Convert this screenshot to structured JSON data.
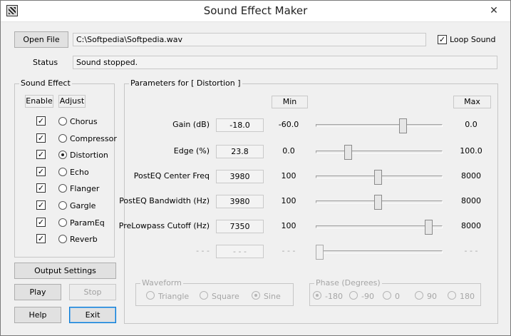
{
  "window": {
    "title": "Sound Effect Maker",
    "close_glyph": "✕"
  },
  "top": {
    "open_file_label": "Open File",
    "file_path": "C:\\Softpedia\\Softpedia.wav",
    "loop_sound_label": "Loop Sound",
    "loop_sound_checked": true,
    "status_label": "Status",
    "status_text": "Sound stopped."
  },
  "sound_effect": {
    "group_title": "Sound Effect",
    "enable_header": "Enable",
    "adjust_header": "Adjust",
    "effects": [
      {
        "name": "Chorus",
        "enabled": true,
        "selected": false
      },
      {
        "name": "Compressor",
        "enabled": true,
        "selected": false
      },
      {
        "name": "Distortion",
        "enabled": true,
        "selected": true
      },
      {
        "name": "Echo",
        "enabled": true,
        "selected": false
      },
      {
        "name": "Flanger",
        "enabled": true,
        "selected": false
      },
      {
        "name": "Gargle",
        "enabled": true,
        "selected": false
      },
      {
        "name": "ParamEq",
        "enabled": true,
        "selected": false
      },
      {
        "name": "Reverb",
        "enabled": true,
        "selected": false
      }
    ]
  },
  "buttons": {
    "output_settings": "Output Settings",
    "play": "Play",
    "stop": "Stop",
    "help": "Help",
    "exit": "Exit"
  },
  "parameters": {
    "group_title": "Parameters for [ Distortion ]",
    "min_header": "Min",
    "max_header": "Max",
    "rows": [
      {
        "name": "Gain (dB)",
        "value": "-18.0",
        "min": "-60.0",
        "max": "0.0",
        "position": 0.7
      },
      {
        "name": "Edge (%)",
        "value": "23.8",
        "min": "0.0",
        "max": "100.0",
        "position": 0.238
      },
      {
        "name": "PostEQ Center Freq",
        "value": "3980",
        "min": "100",
        "max": "8000",
        "position": 0.491
      },
      {
        "name": "PostEQ Bandwidth (Hz)",
        "value": "3980",
        "min": "100",
        "max": "8000",
        "position": 0.491
      },
      {
        "name": "PreLowpass Cutoff (Hz)",
        "value": "7350",
        "min": "100",
        "max": "8000",
        "position": 0.918
      },
      {
        "name": "- - -",
        "value": "- - -",
        "min": "- - -",
        "max": "- - -",
        "position": 0.0,
        "disabled": true
      }
    ]
  },
  "waveform": {
    "group_title": "Waveform",
    "options": [
      {
        "label": "Triangle",
        "checked": false
      },
      {
        "label": "Square",
        "checked": false
      },
      {
        "label": "Sine",
        "checked": true
      }
    ]
  },
  "phase": {
    "group_title": "Phase (Degrees)",
    "options": [
      {
        "label": "-180",
        "checked": true
      },
      {
        "label": "-90",
        "checked": false
      },
      {
        "label": "0",
        "checked": false
      },
      {
        "label": "90",
        "checked": false
      },
      {
        "label": "180",
        "checked": false
      }
    ]
  }
}
